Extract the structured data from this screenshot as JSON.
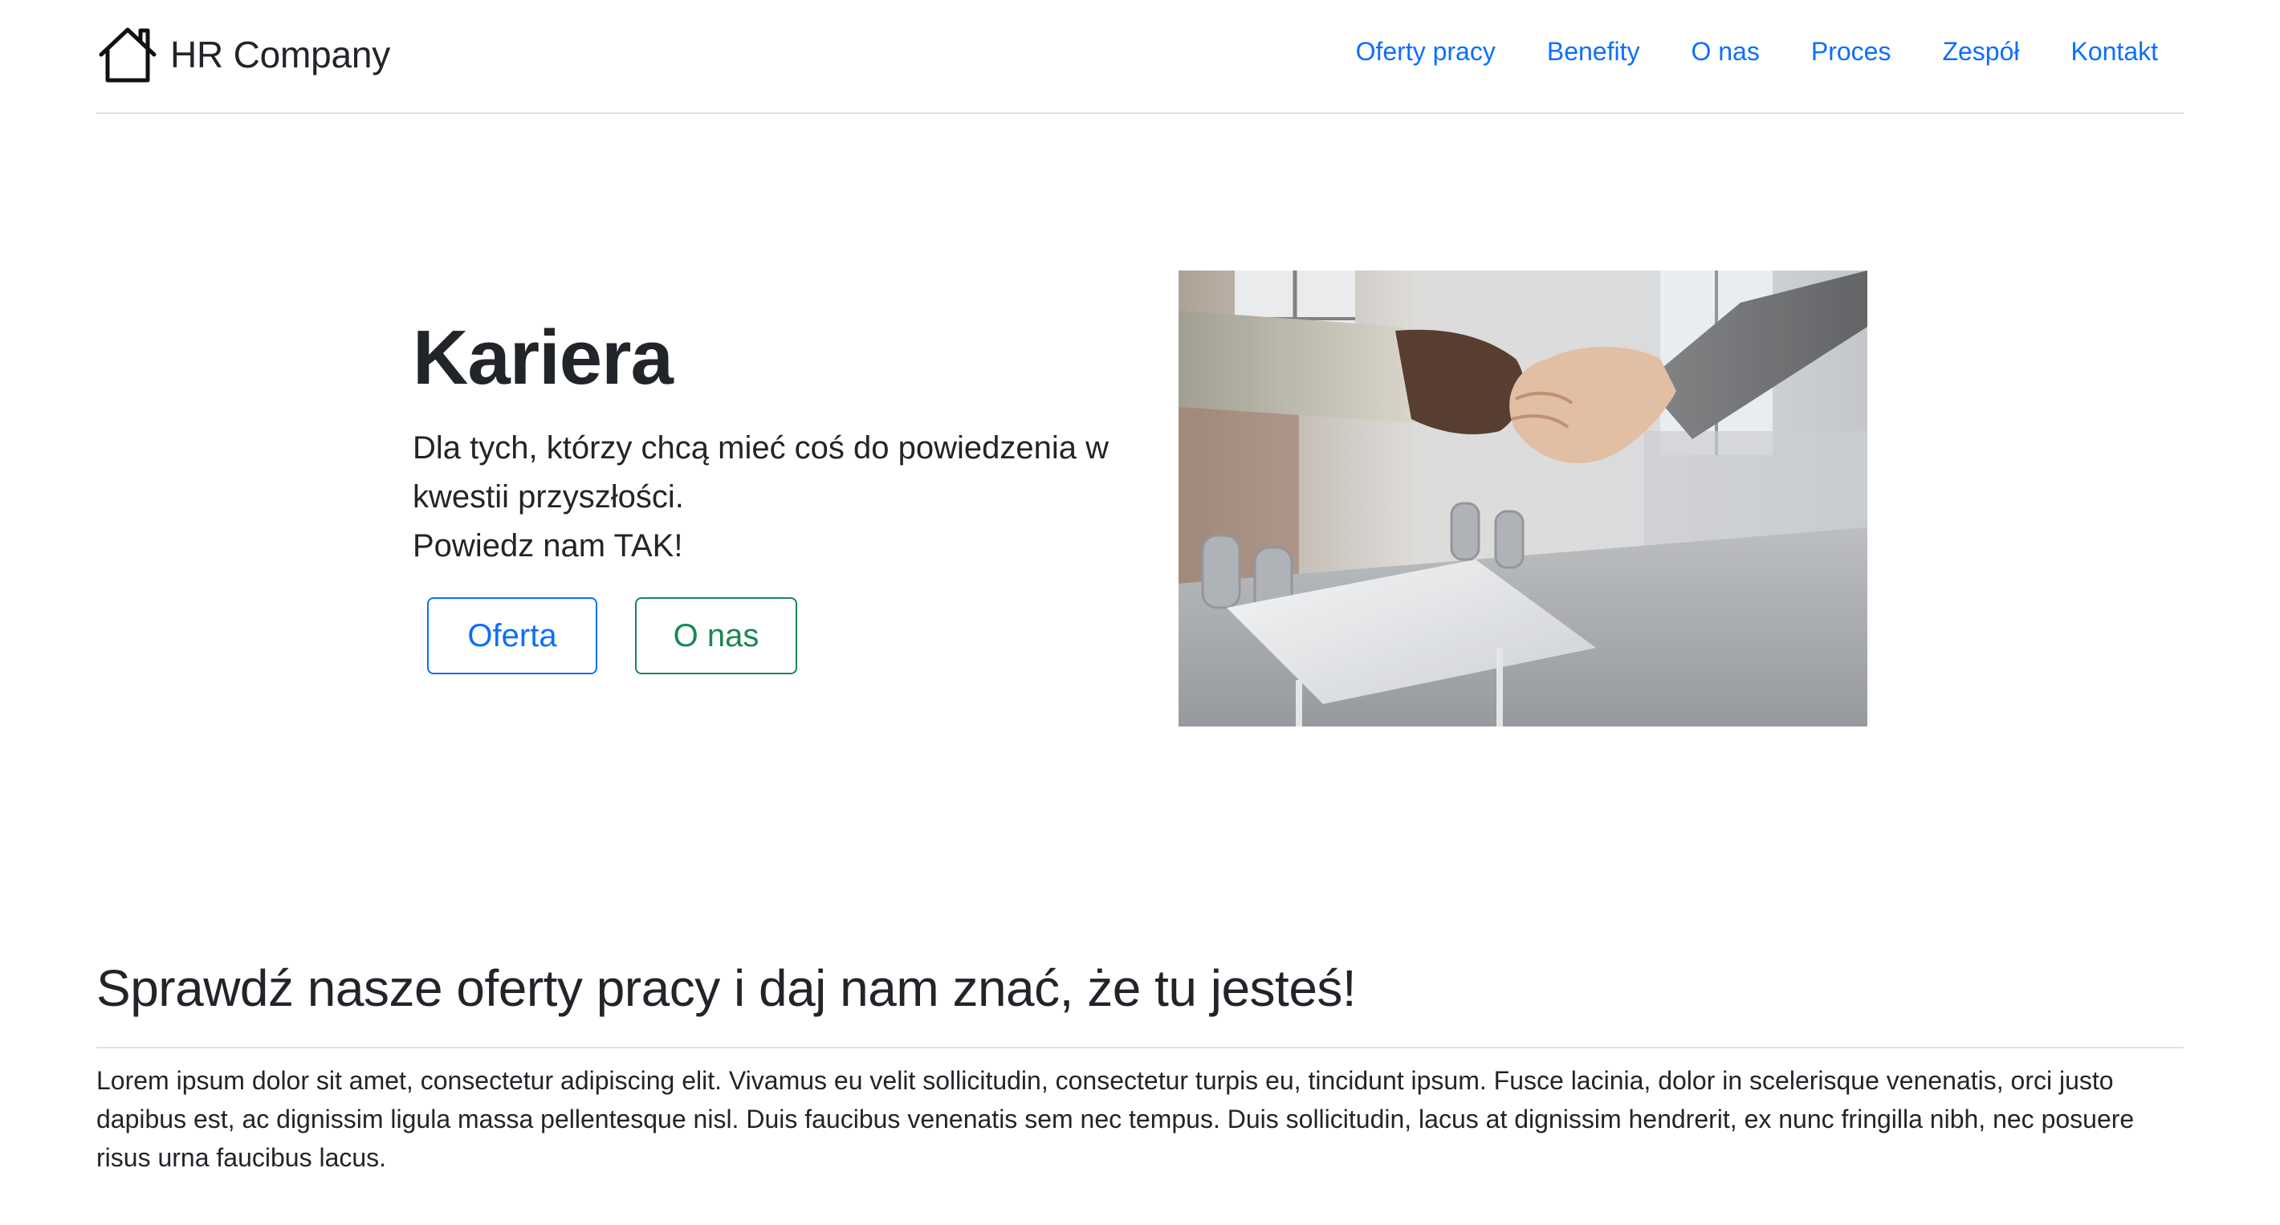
{
  "header": {
    "brand_icon": "house-icon",
    "brand_name": "HR Company",
    "nav": [
      {
        "label": "Oferty pracy"
      },
      {
        "label": "Benefity"
      },
      {
        "label": "O nas"
      },
      {
        "label": "Proces"
      },
      {
        "label": "Zespół"
      },
      {
        "label": "Kontakt"
      }
    ]
  },
  "hero": {
    "title": "Kariera",
    "lead_line1": "Dla tych, którzy chcą mieć coś do powiedzenia w kwestii przyszłości.",
    "lead_line2": "Powiedz nam TAK!",
    "buttons": {
      "primary_label": "Oferta",
      "secondary_label": "O nas"
    },
    "image": "handshake-office-photo"
  },
  "section": {
    "title": "Sprawdź nasze oferty pracy i daj nam znać, że tu jesteś!",
    "text": "Lorem ipsum dolor sit amet, consectetur adipiscing elit. Vivamus eu velit sollicitudin, consectetur turpis eu, tincidunt ipsum. Fusce lacinia, dolor in scelerisque venenatis, orci justo dapibus est, ac dignissim ligula massa pellentesque nisl. Duis faucibus venenatis sem nec tempus. Duis sollicitudin, lacus at dignissim hendrerit, ex nunc fringilla nibh, nec posuere risus urna faucibus lacus."
  },
  "colors": {
    "primary": "#0d6efd",
    "success": "#198754",
    "text": "#212529",
    "border": "#dee2e6"
  }
}
